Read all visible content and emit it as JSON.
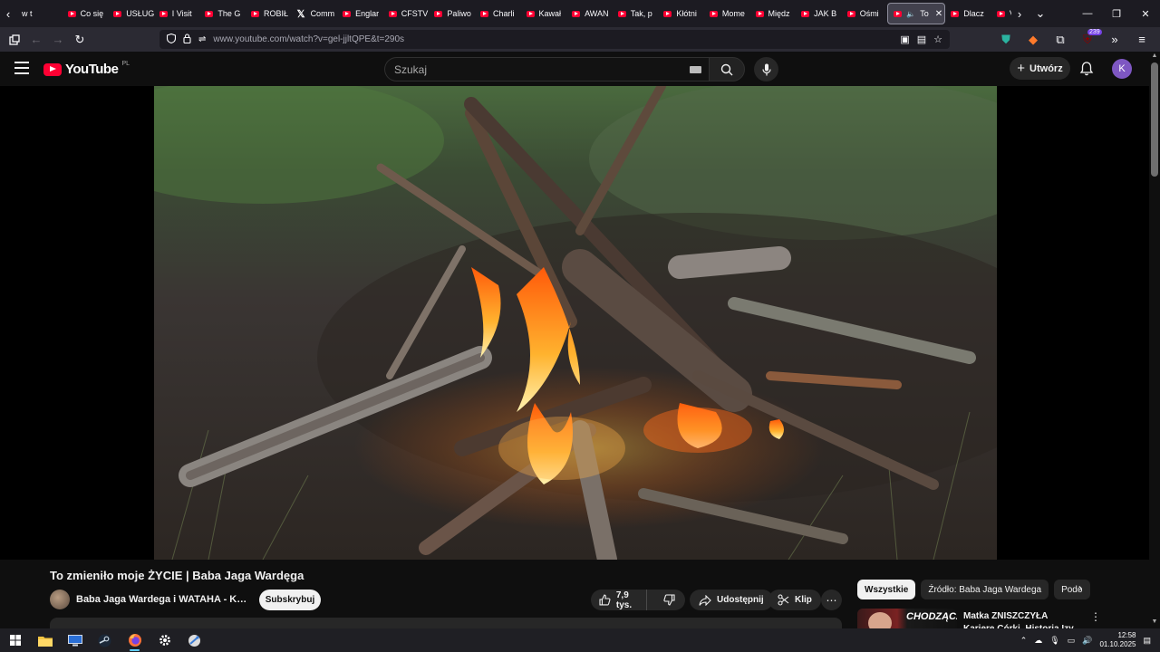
{
  "browser": {
    "tabs": [
      {
        "label": "w t",
        "icon": "none"
      },
      {
        "label": "Co się",
        "icon": "youtube-icon"
      },
      {
        "label": "USŁUG",
        "icon": "youtube-icon"
      },
      {
        "label": "I Visit",
        "icon": "youtube-icon"
      },
      {
        "label": "The G",
        "icon": "youtube-icon"
      },
      {
        "label": "ROBIŁ",
        "icon": "youtube-icon"
      },
      {
        "label": "Comm",
        "icon": "x-icon"
      },
      {
        "label": "Englar",
        "icon": "youtube-icon"
      },
      {
        "label": "CFSTV",
        "icon": "youtube-icon"
      },
      {
        "label": "Paliwo",
        "icon": "youtube-icon"
      },
      {
        "label": "Charli",
        "icon": "youtube-icon"
      },
      {
        "label": "Kawał",
        "icon": "youtube-icon"
      },
      {
        "label": "AWAN",
        "icon": "youtube-icon"
      },
      {
        "label": "Tak, p",
        "icon": "youtube-icon"
      },
      {
        "label": "Kłótni",
        "icon": "youtube-icon"
      },
      {
        "label": "Mome",
        "icon": "youtube-icon"
      },
      {
        "label": "Międz",
        "icon": "youtube-icon"
      },
      {
        "label": "JAK B",
        "icon": "youtube-icon"
      },
      {
        "label": "Ośmi",
        "icon": "youtube-icon"
      },
      {
        "label": "To",
        "icon": "youtube-icon",
        "active": true
      },
      {
        "label": "Dlacz",
        "icon": "youtube-icon"
      },
      {
        "label": "VLOG",
        "icon": "youtube-icon"
      }
    ],
    "url": "www.youtube.com/watch?v=gel-jjltQPE&t=290s",
    "extension_badge": "239"
  },
  "youtube": {
    "logo_text": "YouTube",
    "country_code": "PL",
    "search_placeholder": "Szukaj",
    "create_label": "Utwórz",
    "avatar_letter": "K",
    "accent_color": "#ff0033"
  },
  "video": {
    "title": "To zmieniło moje ŻYCIE | Baba Jaga Wardęga",
    "channel_name": "Baba Jaga Wardega i WATAHA - Krul...",
    "subscribe_label": "Subskrybuj",
    "likes": "7,9 tys.",
    "share_label": "Udostępnij",
    "clip_label": "Klip"
  },
  "sidebar": {
    "chips": [
      "Wszystkie",
      "Źródło: Baba Jaga Wardega",
      "Podo"
    ],
    "recommendation": {
      "thumb_text": "CHODZĄCA",
      "title": "Matka ZNISZCZYŁA Karierę Córki. Historia Izy Kisio"
    }
  },
  "taskbar": {
    "time": "12:58",
    "date": "01.10.2025"
  }
}
